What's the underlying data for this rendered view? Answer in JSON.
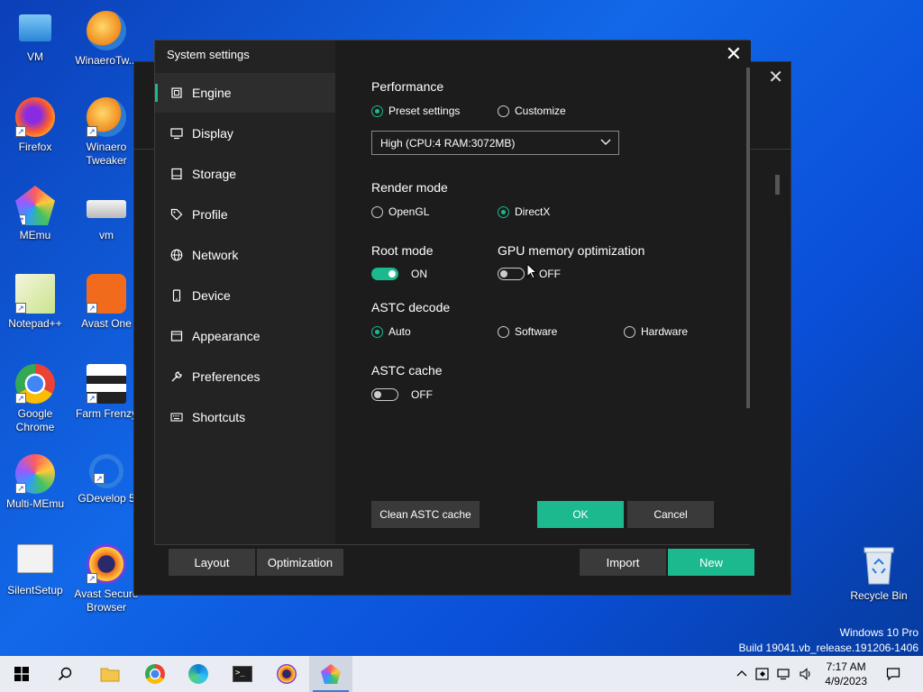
{
  "desktop": {
    "icons": [
      {
        "label": "VM"
      },
      {
        "label": "WinaeroTw..."
      },
      {
        "label": "Firefox"
      },
      {
        "label": "Winaero Tweaker"
      },
      {
        "label": "MEmu"
      },
      {
        "label": "vm"
      },
      {
        "label": "Notepad++"
      },
      {
        "label": "Avast One"
      },
      {
        "label": "Google Chrome"
      },
      {
        "label": "Farm Frenzy"
      },
      {
        "label": "Multi-MEmu"
      },
      {
        "label": "GDevelop 5"
      },
      {
        "label": "SilentSetup"
      },
      {
        "label": "Avast Secure Browser"
      }
    ],
    "recycle_bin": "Recycle Bin",
    "watermark": {
      "line1": "Windows 10 Pro",
      "line2": "Build 19041.vb_release.191206-1406"
    }
  },
  "bg_window": {
    "buttons": {
      "layout": "Layout",
      "optimization": "Optimization",
      "import": "Import",
      "new": "New"
    }
  },
  "dialog": {
    "title": "System settings",
    "nav": [
      {
        "label": "Engine",
        "icon": "cpu-icon"
      },
      {
        "label": "Display",
        "icon": "monitor-icon"
      },
      {
        "label": "Storage",
        "icon": "storage-icon"
      },
      {
        "label": "Profile",
        "icon": "tag-icon"
      },
      {
        "label": "Network",
        "icon": "globe-icon"
      },
      {
        "label": "Device",
        "icon": "phone-icon"
      },
      {
        "label": "Appearance",
        "icon": "window-icon"
      },
      {
        "label": "Preferences",
        "icon": "wrench-icon"
      },
      {
        "label": "Shortcuts",
        "icon": "keyboard-icon"
      }
    ],
    "performance": {
      "title": "Performance",
      "preset": "Preset settings",
      "customize": "Customize",
      "selected": "preset",
      "dropdown_value": "High (CPU:4 RAM:3072MB)"
    },
    "render_mode": {
      "title": "Render mode",
      "opengl": "OpenGL",
      "directx": "DirectX",
      "selected": "directx"
    },
    "root_mode": {
      "title": "Root mode",
      "state": "ON"
    },
    "gpu_mem": {
      "title": "GPU memory optimization",
      "state": "OFF"
    },
    "astc_decode": {
      "title": "ASTC decode",
      "auto": "Auto",
      "software": "Software",
      "hardware": "Hardware",
      "selected": "auto"
    },
    "astc_cache": {
      "title": "ASTC cache",
      "state": "OFF"
    },
    "buttons": {
      "clean": "Clean ASTC cache",
      "ok": "OK",
      "cancel": "Cancel"
    },
    "colors": {
      "accent": "#1bb98d",
      "panel": "#232323",
      "content": "#1c1c1c",
      "button": "#3a3a3a"
    }
  },
  "taskbar": {
    "clock_time": "7:17 AM",
    "clock_date": "4/9/2023"
  }
}
